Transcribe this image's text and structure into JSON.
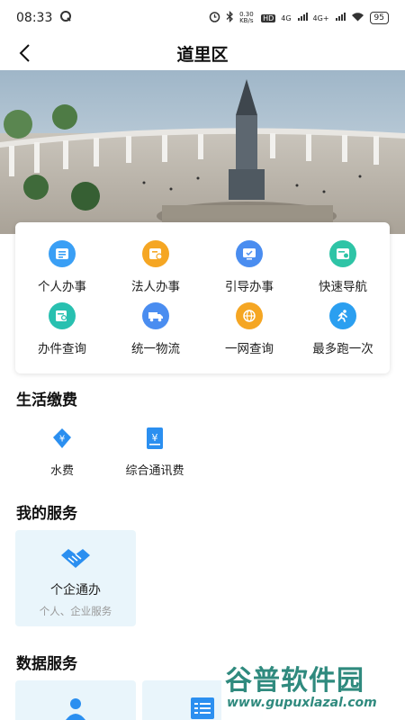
{
  "status_bar": {
    "time": "08:33",
    "net_speed": "0.30 KB/s",
    "hd": "HD",
    "net1": "4G",
    "net2": "4G+",
    "battery": "95"
  },
  "nav": {
    "title": "道里区"
  },
  "services": [
    {
      "label": "个人办事",
      "icon": "id-card-icon",
      "color": "#3a9ff5"
    },
    {
      "label": "法人办事",
      "icon": "business-card-icon",
      "color": "#f5a623"
    },
    {
      "label": "引导办事",
      "icon": "monitor-check-icon",
      "color": "#4a8df0"
    },
    {
      "label": "快速导航",
      "icon": "navigation-card-icon",
      "color": "#2ec4a6"
    },
    {
      "label": "办件查询",
      "icon": "document-search-icon",
      "color": "#28c0b0"
    },
    {
      "label": "统一物流",
      "icon": "truck-icon",
      "color": "#4a8df0"
    },
    {
      "label": "一网查询",
      "icon": "globe-icon",
      "color": "#f5a623"
    },
    {
      "label": "最多跑一次",
      "icon": "runner-icon",
      "color": "#2b9ff0"
    }
  ],
  "life_pay": {
    "title": "生活缴费",
    "items": [
      {
        "label": "水费",
        "icon": "water-drop-yuan-icon"
      },
      {
        "label": "综合通讯费",
        "icon": "bill-yuan-icon"
      }
    ]
  },
  "my_services": {
    "title": "我的服务",
    "card": {
      "title": "个企通办",
      "subtitle": "个人、企业服务",
      "icon": "handshake-icon"
    }
  },
  "data_services": {
    "title": "数据服务"
  },
  "watermark": {
    "main": "谷普软件园",
    "sub": "www.gupuxlazal.com"
  },
  "colors": {
    "accent": "#2b8ff0",
    "card_bg": "#e9f5fb",
    "watermark": "#2f8a7e"
  }
}
